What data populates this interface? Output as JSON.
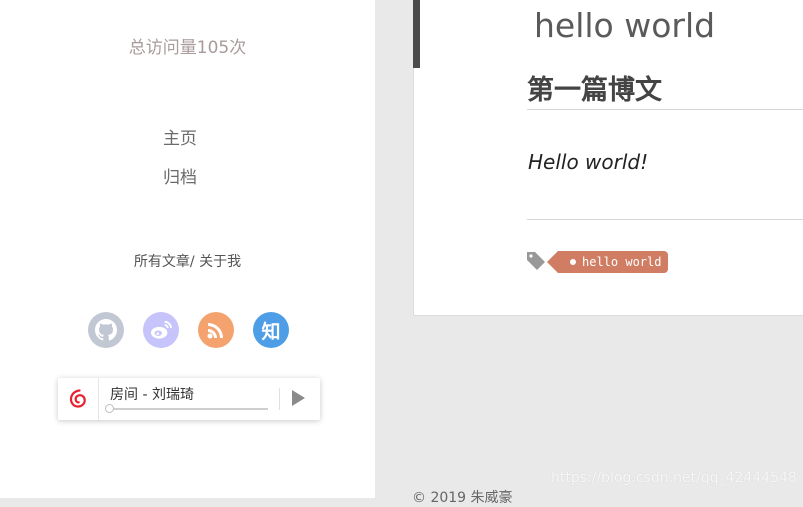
{
  "sidebar": {
    "visits_text": "总访问量105次",
    "nav": [
      {
        "label": "主页"
      },
      {
        "label": "归档"
      }
    ],
    "links": {
      "all_posts": "所有文章",
      "separator": "/",
      "about": "关于我"
    },
    "social": [
      {
        "name": "github",
        "color": "#c2c7d4"
      },
      {
        "name": "weibo",
        "color": "#c6c4fa"
      },
      {
        "name": "rss",
        "color": "#f4a36e"
      },
      {
        "name": "zhihu",
        "color": "#4d9ee6",
        "glyph": "知"
      }
    ],
    "player": {
      "song": "房间 - 刘瑞琦",
      "progress": 0,
      "logo_color": "#e8202f"
    }
  },
  "post": {
    "header": "hello world",
    "title": "第一篇博文",
    "body": "Hello world!",
    "tag": "hello world",
    "tag_color": "#d07d63"
  },
  "footer": {
    "copyright": "© 2019 朱威豪"
  },
  "watermark": "https://blog.csdn.net/qq_42444548"
}
